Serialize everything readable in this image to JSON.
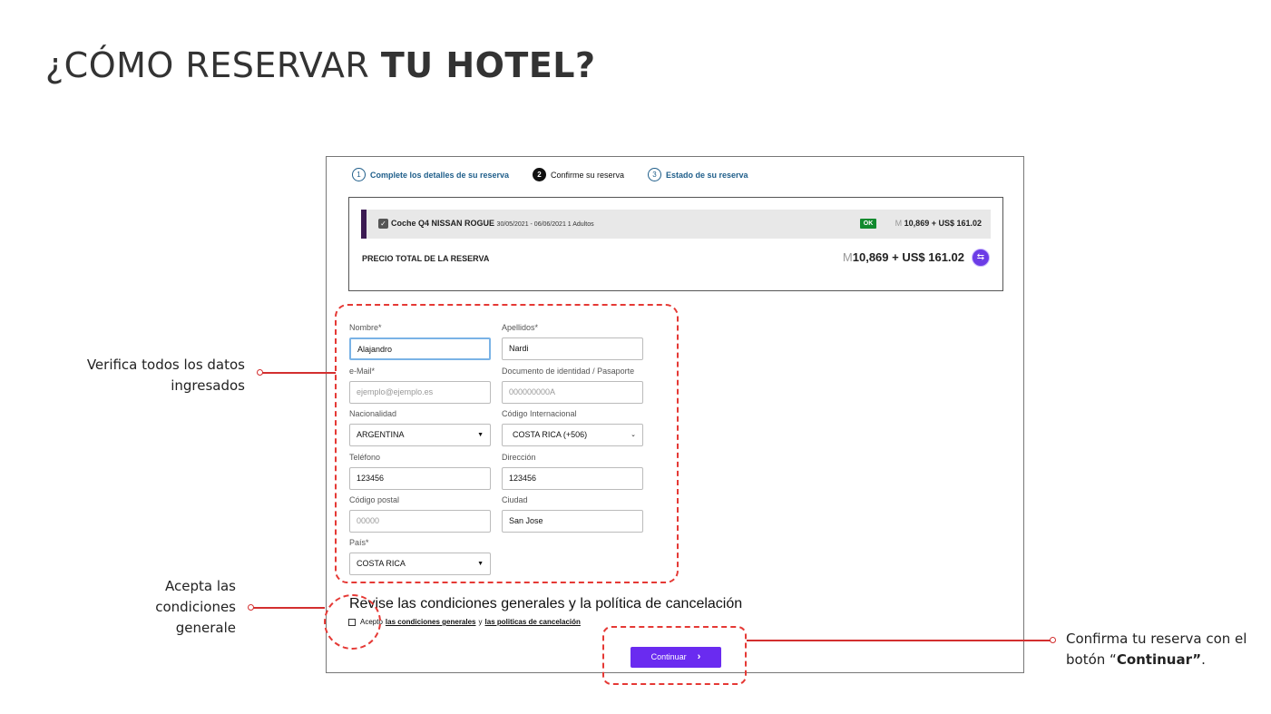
{
  "page": {
    "title_light": "¿CÓMO RESERVAR ",
    "title_bold": "TU HOTEL?"
  },
  "steps": [
    {
      "num": "1",
      "label": "Complete los detalles de su reserva"
    },
    {
      "num": "2",
      "label": "Confirme su reserva"
    },
    {
      "num": "3",
      "label": "Estado de su reserva"
    }
  ],
  "summary": {
    "item_name": "Coche Q4 NISSAN ROGUE",
    "item_details": "30/05/2021 - 06/06/2021 1 Adultos",
    "status": "OK",
    "item_price": "10,869 + US$ 161.02",
    "total_label": "PRECIO TOTAL DE LA RESERVA",
    "total_price": "10,869 + US$ 161.02",
    "currency_symbol": "M",
    "accent_color": "#6c3ce6"
  },
  "form": {
    "nombre": {
      "label": "Nombre*",
      "value": "Alajandro"
    },
    "apellidos": {
      "label": "Apellidos*",
      "value": "Nardi"
    },
    "email": {
      "label": "e-Mail*",
      "placeholder": "ejemplo@ejemplo.es"
    },
    "documento": {
      "label": "Documento de identidad / Pasaporte",
      "placeholder": "000000000A"
    },
    "nacionalidad": {
      "label": "Nacionalidad",
      "value": "ARGENTINA"
    },
    "codigo_int": {
      "label": "Código Internacional",
      "value": "COSTA RICA (+506)"
    },
    "telefono": {
      "label": "Teléfono",
      "value": "123456"
    },
    "direccion": {
      "label": "Dirección",
      "value": "123456"
    },
    "codigo_postal": {
      "label": "Código postal",
      "placeholder": "00000"
    },
    "ciudad": {
      "label": "Ciudad",
      "value": "San Jose"
    },
    "pais": {
      "label": "País*",
      "value": "COSTA RICA"
    }
  },
  "conditions": {
    "title": "Revise las condiciones generales y la política de cancelación",
    "accept": "Acepto",
    "link1": "las condiciones generales",
    "and": "y",
    "link2": "las politicas de cancelación"
  },
  "button": {
    "label": "Continuar"
  },
  "annotations": {
    "verify_1": "Verifica todos los datos",
    "verify_2": "ingresados",
    "accept_1": "Acepta las",
    "accept_2": "condiciones",
    "accept_3": "generale",
    "confirm_1": "Confirma tu reserva con el",
    "confirm_2a": "botón “",
    "confirm_2b": "Continuar”",
    "confirm_2c": "."
  }
}
